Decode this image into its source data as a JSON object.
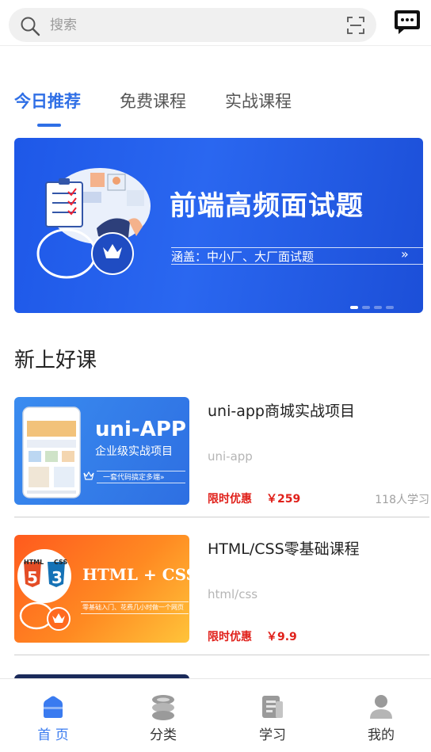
{
  "search": {
    "placeholder": "搜索"
  },
  "tabs": [
    {
      "label": "今日推荐",
      "active": true
    },
    {
      "label": "免费课程",
      "active": false
    },
    {
      "label": "实战课程",
      "active": false
    }
  ],
  "banner": {
    "title": "前端高频面试题",
    "subtitle": "涵盖：中小厂、大厂面试题",
    "arrow": "»",
    "slide_count": 4,
    "active_slide": 1
  },
  "section": {
    "title": "新上好课"
  },
  "courses": [
    {
      "name": "uni-app商城实战项目",
      "tag": "uni-app",
      "promo": "限时优惠",
      "price": "￥259",
      "learners": "118人学习",
      "thumb": {
        "title": "uni-APP",
        "subtitle": "企业级实战项目",
        "caption": "一套代码搞定多端»"
      }
    },
    {
      "name": "HTML/CSS零基础课程",
      "tag": "html/css",
      "promo": "限时优惠",
      "price": "￥9.9",
      "learners": "",
      "thumb": {
        "title": "HTML + CSS",
        "caption": "零基础入门、花费几小时做一个网页",
        "badge_left": "HTML",
        "badge_right": "CSS",
        "num_left": "5",
        "num_right": "3"
      }
    }
  ],
  "bottom_nav": [
    {
      "label": "首 页",
      "icon": "home-icon",
      "active": true
    },
    {
      "label": "分类",
      "icon": "category-icon",
      "active": false
    },
    {
      "label": "学习",
      "icon": "study-icon",
      "active": false
    },
    {
      "label": "我的",
      "icon": "profile-icon",
      "active": false
    }
  ],
  "colors": {
    "accent": "#2f6fe6",
    "price_red": "#e0201a",
    "banner_blue": "#1e58e8",
    "nav_active": "#3a7bf0"
  }
}
